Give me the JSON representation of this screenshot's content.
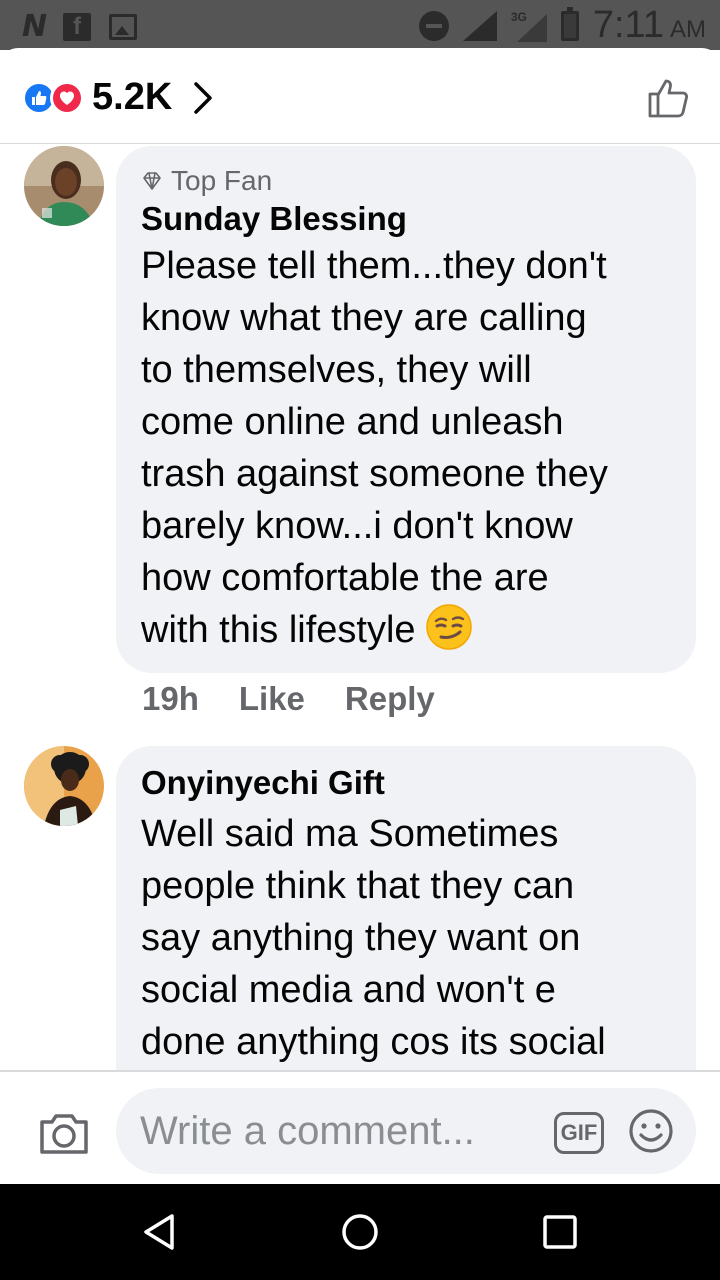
{
  "status_bar": {
    "time": "7:11",
    "ampm": "AM",
    "network_label": "3G",
    "icons": [
      "n-app-icon",
      "facebook-icon",
      "image-icon",
      "do-not-disturb-icon",
      "signal-icon",
      "battery-icon"
    ]
  },
  "header": {
    "reaction_icons": [
      "like-reaction-icon",
      "love-reaction-icon"
    ],
    "reaction_count": "5.2K",
    "colors": {
      "like": "#1877f2",
      "love": "#f0284a"
    }
  },
  "comments": [
    {
      "badge": "Top Fan",
      "author": "Sunday Blessing",
      "lines": [
        "Please tell them...they don't",
        "know what they are calling",
        "to themselves, they will",
        "come online and unleash",
        "trash against someone they",
        "barely know...i don't know",
        "how comfortable the are",
        "with this lifestyle"
      ],
      "emoji": "smirk-emoji",
      "time": "19h",
      "like_label": "Like",
      "reply_label": "Reply"
    },
    {
      "author": "Onyinyechi Gift",
      "lines": [
        "Well said ma Sometimes",
        "people think that they can",
        "say anything they want on",
        "social media and won't e",
        "done anything cos its social"
      ]
    }
  ],
  "composer": {
    "placeholder": "Write a comment...",
    "gif_label": "GIF"
  },
  "navbar": {
    "buttons": [
      "back",
      "home",
      "recents"
    ]
  }
}
